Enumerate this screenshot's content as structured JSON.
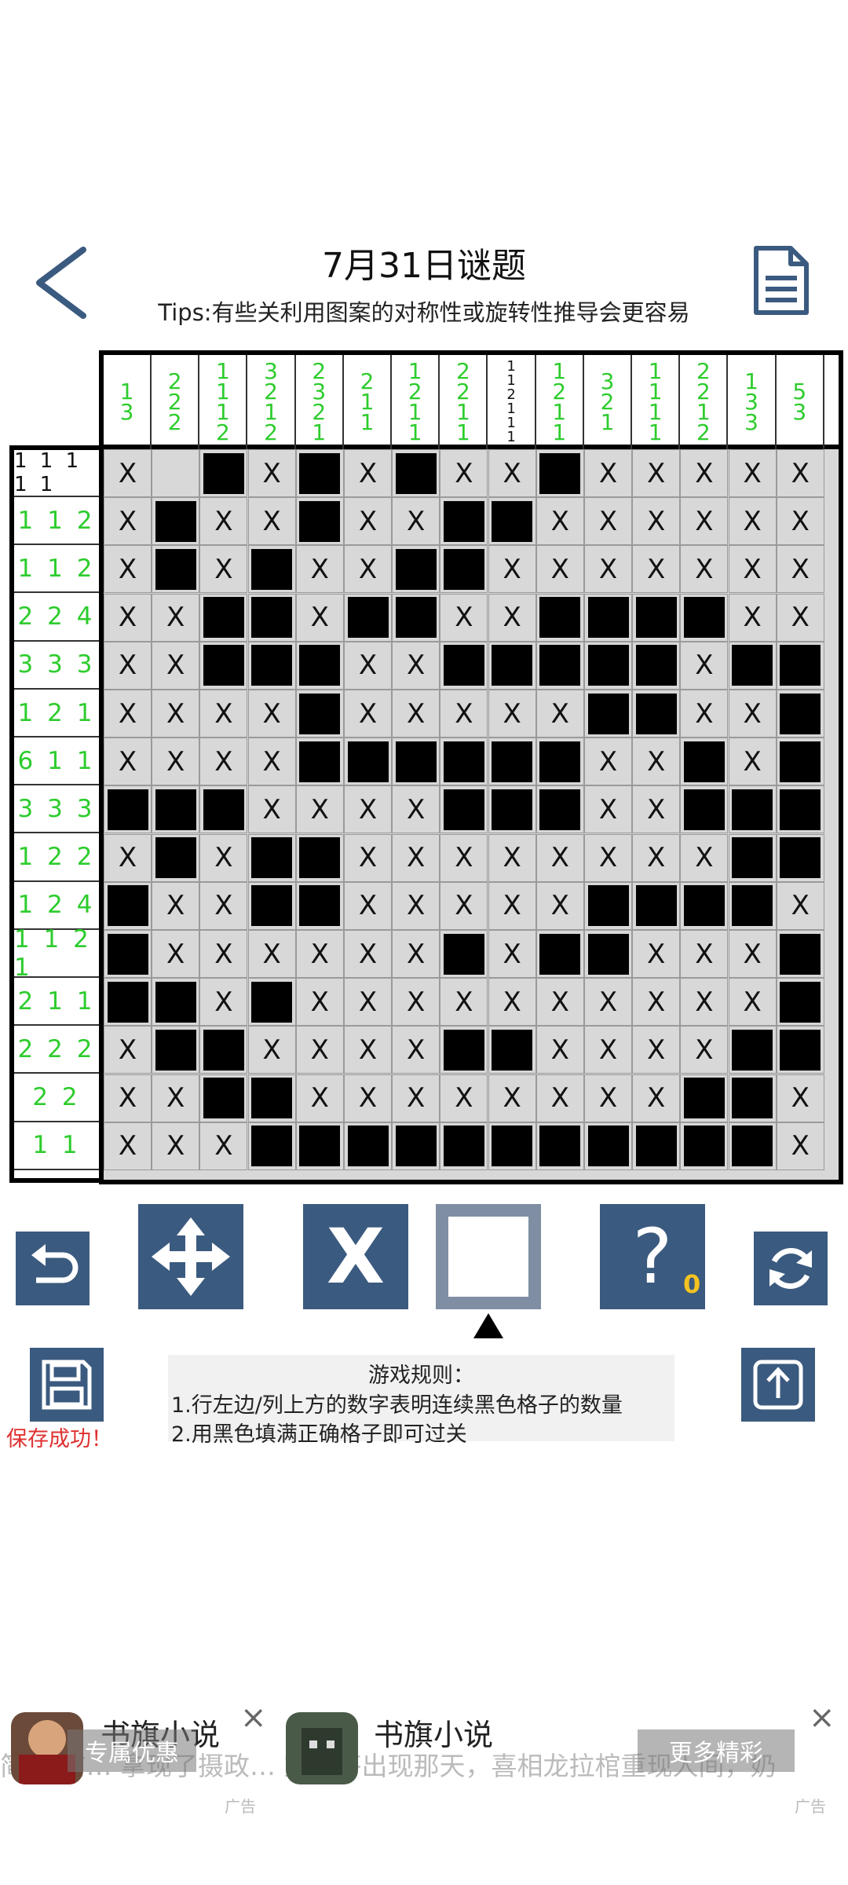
{
  "header": {
    "title": "7月31日谜题",
    "tips": "Tips:有些关利用图案的对称性或旋转性推导会更容易"
  },
  "col_clues": [
    {
      "nums": [
        "1",
        "3"
      ],
      "color": "green"
    },
    {
      "nums": [
        "2",
        "2",
        "2"
      ],
      "color": "green"
    },
    {
      "nums": [
        "1",
        "1",
        "1",
        "2"
      ],
      "color": "green"
    },
    {
      "nums": [
        "3",
        "2",
        "1",
        "2"
      ],
      "color": "green"
    },
    {
      "nums": [
        "2",
        "3",
        "2",
        "1"
      ],
      "color": "green"
    },
    {
      "nums": [
        "2",
        "1",
        "1"
      ],
      "color": "green"
    },
    {
      "nums": [
        "1",
        "2",
        "1",
        "1"
      ],
      "color": "green"
    },
    {
      "nums": [
        "2",
        "2",
        "1",
        "1"
      ],
      "color": "green"
    },
    {
      "nums": [
        "1",
        "1",
        "2",
        "1",
        "1",
        "1"
      ],
      "color": "black"
    },
    {
      "nums": [
        "1",
        "2",
        "1",
        "1"
      ],
      "color": "green"
    },
    {
      "nums": [
        "3",
        "2",
        "1"
      ],
      "color": "green"
    },
    {
      "nums": [
        "1",
        "1",
        "1",
        "1"
      ],
      "color": "green"
    },
    {
      "nums": [
        "2",
        "2",
        "1",
        "2"
      ],
      "color": "green"
    },
    {
      "nums": [
        "1",
        "3",
        "3"
      ],
      "color": "green"
    },
    {
      "nums": [
        "5",
        "3"
      ],
      "color": "green"
    }
  ],
  "row_clues": [
    {
      "text": "1 1 1 1 1",
      "color": "black"
    },
    {
      "text": "1 1 2",
      "color": "green"
    },
    {
      "text": "1 1 2",
      "color": "green"
    },
    {
      "text": "2 2 4",
      "color": "green"
    },
    {
      "text": "3 3 3",
      "color": "green"
    },
    {
      "text": "1 2 1",
      "color": "green"
    },
    {
      "text": "6 1 1",
      "color": "green"
    },
    {
      "text": "3 3 3",
      "color": "green"
    },
    {
      "text": "1 2 2",
      "color": "green"
    },
    {
      "text": "1 2 4",
      "color": "green"
    },
    {
      "text": "1 1 2 1",
      "color": "green"
    },
    {
      "text": "2 1 1",
      "color": "green"
    },
    {
      "text": "2 2 2",
      "color": "green"
    },
    {
      "text": "2 2",
      "color": "green"
    },
    {
      "text": "1 1",
      "color": "green"
    }
  ],
  "grid": [
    "X.#X#X#XX#XXXXX",
    "X#XX#XX##XXXXXX",
    "X#X#XX##XXXXXXX",
    "XX##X##XX####XX",
    "XX###XX#####X##",
    "XXXX#XXXXX##XX#",
    "XXXX######XX#X#",
    "###XXXX###XX###",
    "X#X##XXXXXXXX##",
    "#XX##XXXXX####X",
    "#XXXXXX#X##XXX#",
    "##X#XXXXXXXXXX#",
    "X##XXXX##XXXX##",
    "XX##XXXXXXXX##X",
    "XXX###########X"
  ],
  "cell_mark_glyph": "X",
  "tools": {
    "x_label": "X",
    "hint_label": "?",
    "hint_count": "0"
  },
  "rules": {
    "heading": "游戏规则：",
    "line1": "1.行左边/列上方的数字表明连续黑色格子的数量",
    "line2": "2.用黑色填满正确格子即可过关"
  },
  "save_message": "保存成功！",
  "ads": {
    "left_title": "书旗小说",
    "left_button": "专属优惠",
    "right_title": "书旗小说",
    "right_button": "更多精彩",
    "close_glyph": "×",
    "ad_tag": "广告",
    "marquee": "简… 前… 拿现了摄政… 重答答出现那天，喜相龙拉棺重现人间，奶"
  },
  "colors": {
    "tool_blue": "#3b5a7f",
    "clue_green": "#2ecc2e",
    "save_red": "#e03030",
    "hint_badge": "#f4c320"
  }
}
